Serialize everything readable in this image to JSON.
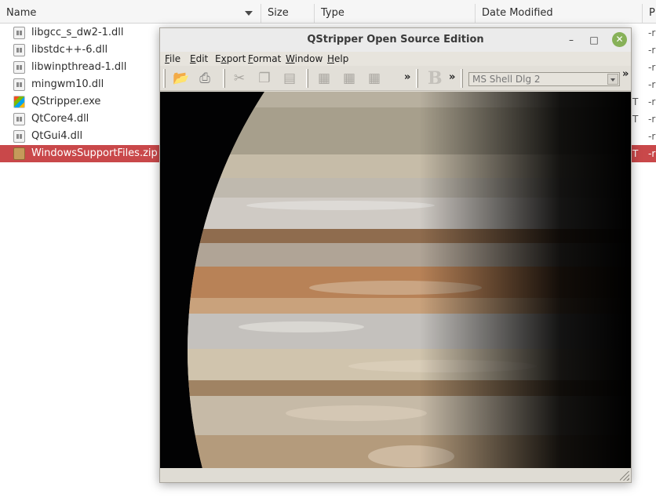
{
  "file_manager": {
    "columns": {
      "name": "Name",
      "size": "Size",
      "type": "Type",
      "date": "Date Modified",
      "perm": "P"
    },
    "files": [
      {
        "name": "libgcc_s_dw2-1.dll",
        "icon": "dll-file-icon",
        "tail": "",
        "perm": "-r"
      },
      {
        "name": "libstdc++-6.dll",
        "icon": "dll-file-icon",
        "tail": "",
        "perm": "-r"
      },
      {
        "name": "libwinpthread-1.dll",
        "icon": "dll-file-icon",
        "tail": "",
        "perm": "-r"
      },
      {
        "name": "mingwm10.dll",
        "icon": "dll-file-icon",
        "tail": "",
        "perm": "-r"
      },
      {
        "name": "QStripper.exe",
        "icon": "exe-file-icon",
        "tail": "T",
        "perm": "-r"
      },
      {
        "name": "QtCore4.dll",
        "icon": "dll-file-icon",
        "tail": "T",
        "perm": "-r"
      },
      {
        "name": "QtGui4.dll",
        "icon": "dll-file-icon",
        "tail": "",
        "perm": "-r"
      },
      {
        "name": "WindowsSupportFiles.zip",
        "icon": "zip-file-icon",
        "tail": "T",
        "perm": "-r",
        "selected": true
      }
    ],
    "selection_color": "#c9484a"
  },
  "window": {
    "title": "QStripper Open Source Edition",
    "controls": {
      "minimize": "–",
      "maximize": "□",
      "close": "✕"
    },
    "menu": [
      {
        "accel": "F",
        "rest": "ile"
      },
      {
        "accel": "E",
        "rest": "dit"
      },
      {
        "pre": "E",
        "accel": "x",
        "rest": "port"
      },
      {
        "accel": "F",
        "rest": "ormat"
      },
      {
        "accel": "W",
        "rest": "indow"
      },
      {
        "accel": "H",
        "rest": "elp"
      }
    ],
    "toolbar": {
      "font_value": "MS Shell Dlg 2",
      "overflow": "»",
      "bold_label": "B"
    }
  }
}
